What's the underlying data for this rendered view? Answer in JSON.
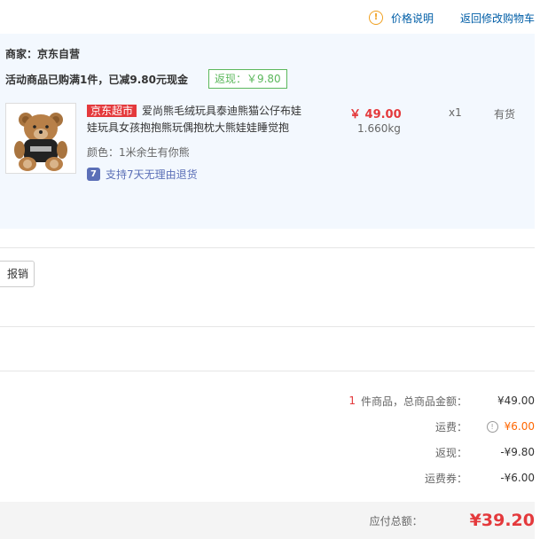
{
  "top_links": {
    "price_note": "价格说明",
    "back_to_cart": "返回修改购物车"
  },
  "order": {
    "shop_label": "商家：京东自营",
    "promo_text": "活动商品已购满1件，已减9.80元现金",
    "rebate_badge": "返现：￥9.80",
    "item": {
      "market_badge": "京东超市",
      "title": "爱尚熊毛绒玩具泰迪熊猫公仔布娃娃玩具女孩抱抱熊玩偶抱枕大熊娃娃睡觉抱",
      "price": "￥ 49.00",
      "weight": "1.660kg",
      "quantity": "x1",
      "stock": "有货",
      "color": "颜色：1米余生有你熊",
      "return_policy": "支持7天无理由退货"
    }
  },
  "invoice": {
    "label": "报销"
  },
  "summary": {
    "count": "1",
    "count_label": "件商品，总商品金额：",
    "goods_total": "¥49.00",
    "shipping_label": "运费：",
    "shipping_value": "¥6.00",
    "rebate_label": "返现：",
    "rebate_value": "-¥9.80",
    "shipping_coupon_label": "运费券：",
    "shipping_coupon_value": "-¥6.00",
    "payable_label": "应付总额：",
    "payable_value": "¥39.20"
  },
  "colors": {
    "accent_red": "#e4393c",
    "link_blue": "#005ea7",
    "green": "#5cb85c",
    "orange": "#ff6600",
    "panel_bg": "#f3f8fe"
  }
}
